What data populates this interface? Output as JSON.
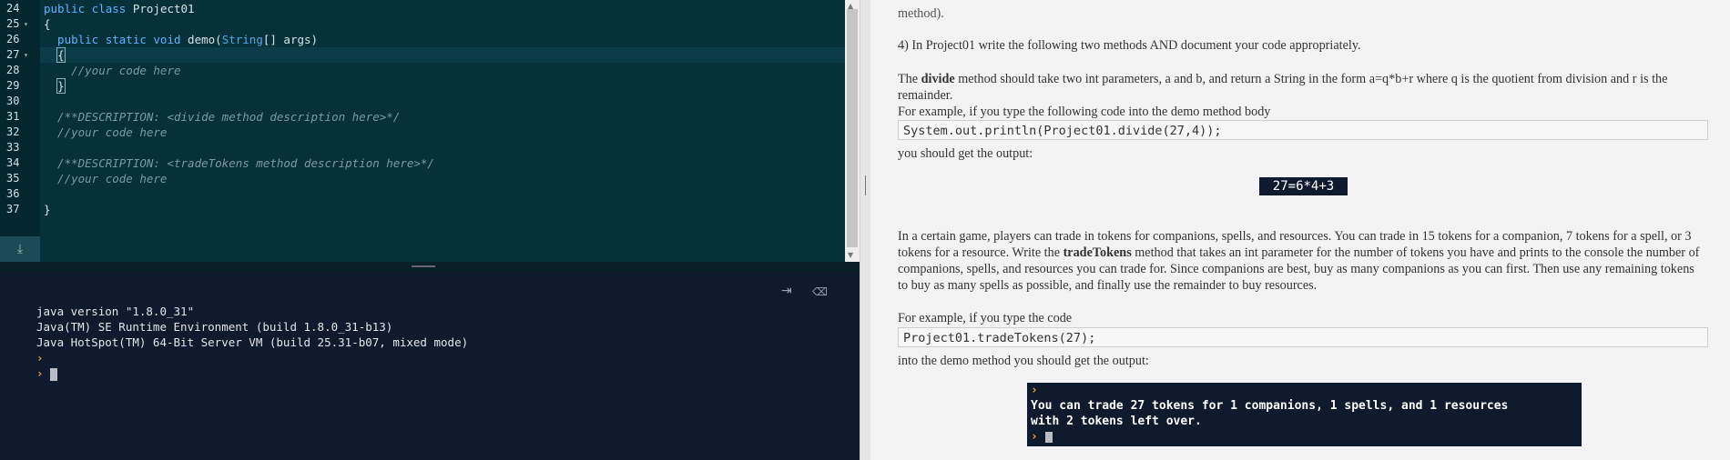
{
  "editor": {
    "lines": [
      {
        "num": "24",
        "fold": "",
        "tokens": [
          {
            "t": "public class ",
            "c": "kw"
          },
          {
            "t": "Project01",
            "c": ""
          }
        ]
      },
      {
        "num": "25",
        "fold": "▾",
        "tokens": [
          {
            "t": "{",
            "c": ""
          }
        ]
      },
      {
        "num": "26",
        "fold": "",
        "tokens": [
          {
            "t": "  public static void ",
            "c": "kw"
          },
          {
            "t": "demo(",
            "c": ""
          },
          {
            "t": "String",
            "c": "ty"
          },
          {
            "t": "[] args)",
            "c": ""
          }
        ]
      },
      {
        "num": "27",
        "fold": "▾",
        "tokens": [
          {
            "t": "  {",
            "c": "brace"
          }
        ]
      },
      {
        "num": "28",
        "fold": "",
        "tokens": [
          {
            "t": "    //your code here",
            "c": "cm"
          }
        ]
      },
      {
        "num": "29",
        "fold": "",
        "tokens": [
          {
            "t": "  }",
            "c": "brace"
          }
        ]
      },
      {
        "num": "30",
        "fold": "",
        "tokens": []
      },
      {
        "num": "31",
        "fold": "",
        "tokens": [
          {
            "t": "  /**DESCRIPTION: <divide method description here>*/",
            "c": "cm"
          }
        ]
      },
      {
        "num": "32",
        "fold": "",
        "tokens": [
          {
            "t": "  //your code here",
            "c": "cm"
          }
        ]
      },
      {
        "num": "33",
        "fold": "",
        "tokens": []
      },
      {
        "num": "34",
        "fold": "",
        "tokens": [
          {
            "t": "  /**DESCRIPTION: <tradeTokens method description here>*/",
            "c": "cm"
          }
        ]
      },
      {
        "num": "35",
        "fold": "",
        "tokens": [
          {
            "t": "  //your code here",
            "c": "cm"
          }
        ]
      },
      {
        "num": "36",
        "fold": "",
        "tokens": []
      },
      {
        "num": "37",
        "fold": "",
        "tokens": [
          {
            "t": "}",
            "c": ""
          }
        ]
      }
    ]
  },
  "console": {
    "lines": [
      "java version \"1.8.0_31\"",
      "Java(TM) SE Runtime Environment (build 1.8.0_31-b13)",
      "Java HotSpot(TM) 64-Bit Server VM (build 25.31-b07, mixed mode)"
    ],
    "prompt": "›"
  },
  "instructions": {
    "top_partial": "method).",
    "item4": "4) In Project01 write the following two methods AND document your code appropriately.",
    "divide_pre": "The ",
    "divide_bold": "divide",
    "divide_post": " method should take two int parameters, a and b, and return a String in the form a=q*b+r where q is the quotient from division and r is the remainder.",
    "example1": "For example, if you type the following code into the demo method body",
    "code1": "System.out.println(Project01.divide(27,4));",
    "output_label1": "you should get the output:",
    "output1": "27=6*4+3",
    "trade_pre": "In a certain game, players can trade in tokens for companions, spells, and resources. You can trade in 15 tokens for a companion, 7 tokens for a spell, or 3 tokens for a resource. Write the ",
    "trade_bold": "tradeTokens",
    "trade_post": " method that takes an int parameter for the number of tokens you have and prints to the console the number of companions, spells, and resources you can trade for. Since companions are best, buy as many companions as you can first. Then use any remaining tokens to buy as many spells as possible, and finally use the remainder to buy resources.",
    "example2": "For example, if you type the code",
    "code2": "Project01.tradeTokens(27);",
    "output_label2": "into the demo method you should get the output:",
    "output2_line1": "You can trade 27 tokens for 1 companions, 1 spells, and 1 resources",
    "output2_line2": "with 2 tokens left over."
  },
  "colors": {
    "editor_bg": "#06303a",
    "console_bg": "#0f1a2e",
    "prompt": "#e8a93a",
    "keyword": "#5fb3ff"
  },
  "icons": {
    "download": "download-icon",
    "console_clear": "clear-console-icon",
    "console_exit": "exit-console-icon"
  }
}
